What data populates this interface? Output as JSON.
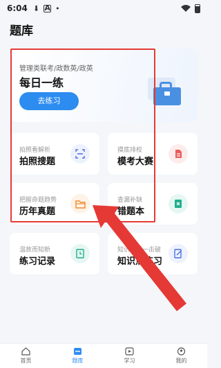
{
  "status_bar": {
    "time": "6:04",
    "icons": [
      "download-icon",
      "a-box-icon",
      "dot-icon",
      "wifi-icon",
      "battery-icon"
    ]
  },
  "page_title": "题库",
  "daily": {
    "subtitle": "管理类联考/政数英/政英",
    "title": "每日一练",
    "button": "去练习",
    "colors": {
      "button": "#2d8cf0"
    }
  },
  "tiles": [
    {
      "sub": "拍照看解析",
      "title": "拍照搜题",
      "icon": "scan-icon",
      "tone": "blue"
    },
    {
      "sub": "摸底排校",
      "title": "模考大赛",
      "icon": "document-icon",
      "tone": "red"
    },
    {
      "sub": "把握命题趋势",
      "title": "历年真题",
      "icon": "folder-icon",
      "tone": "orange"
    },
    {
      "sub": "查漏补缺",
      "title": "错题本",
      "icon": "error-book-icon",
      "tone": "teal"
    },
    {
      "sub": "温故而知新",
      "title": "练习记录",
      "icon": "record-icon",
      "tone": "teal"
    },
    {
      "sub": "知识点逐一击破",
      "title": "知识点练习",
      "icon": "edit-icon",
      "tone": "blue"
    }
  ],
  "tabbar": [
    {
      "label": "首页",
      "icon": "home-icon",
      "active": false
    },
    {
      "label": "题库",
      "icon": "question-bank-icon",
      "active": true
    },
    {
      "label": "学习",
      "icon": "play-icon",
      "active": false
    },
    {
      "label": "我的",
      "icon": "user-icon",
      "active": false
    }
  ],
  "annotation_color": "#e53935"
}
